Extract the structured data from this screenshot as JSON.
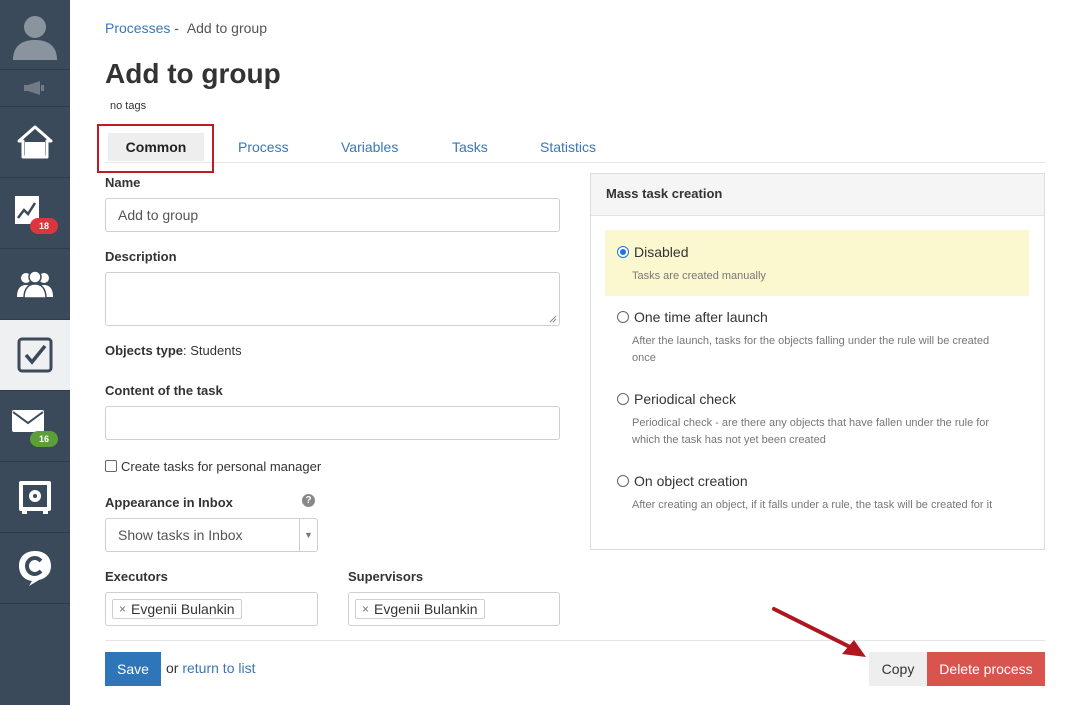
{
  "sidebar": {
    "mail_badge": "16",
    "chart_badge": "18",
    "icons": [
      "avatar-icon",
      "speaker-icon",
      "home-icon",
      "chart-icon",
      "people-icon",
      "tasks-icon",
      "mail-icon",
      "safe-icon",
      "logo-icon"
    ]
  },
  "breadcrumb": {
    "parent": "Processes",
    "separator": "-",
    "current": "Add to group"
  },
  "page": {
    "title": "Add to group",
    "tags": "no tags"
  },
  "tabs": [
    "Common",
    "Process",
    "Variables",
    "Tasks",
    "Statistics"
  ],
  "form": {
    "name_label": "Name",
    "name_value": "Add to group",
    "description_label": "Description",
    "description_value": "",
    "objects_type_label": "Objects type",
    "objects_type_value": "Students",
    "content_label": "Content of the task",
    "content_value": "",
    "personal_manager_label": "Create tasks for personal manager",
    "appearance_label": "Appearance in Inbox",
    "appearance_value": "Show tasks in Inbox",
    "executors_label": "Executors",
    "executors": [
      "Evgenii Bulankin"
    ],
    "supervisors_label": "Supervisors",
    "supervisors": [
      "Evgenii Bulankin"
    ]
  },
  "mass_task": {
    "title": "Mass task creation",
    "options": [
      {
        "label": "Disabled",
        "description": "Tasks are created manually",
        "selected": true
      },
      {
        "label": "One time after launch",
        "description": "After the launch, tasks for the objects falling under the rule will be created once",
        "selected": false
      },
      {
        "label": "Periodical check",
        "description": "Periodical check - are there any objects that have fallen under the rule for which the task has not yet been created",
        "selected": false
      },
      {
        "label": "On object creation",
        "description": "After creating an object, if it falls under a rule, the task will be created for it",
        "selected": false
      }
    ]
  },
  "footer": {
    "save_label": "Save",
    "or_text": "or",
    "return_link": "return to list",
    "copy_label": "Copy",
    "delete_label": "Delete process"
  },
  "colors": {
    "sidebar_bg": "#3b4a5a",
    "link": "#3a77b4",
    "save_button": "#2e76b9",
    "delete_button": "#d9534f",
    "highlight_box": "#c01b22",
    "selected_option_bg": "#fbf8d0"
  }
}
